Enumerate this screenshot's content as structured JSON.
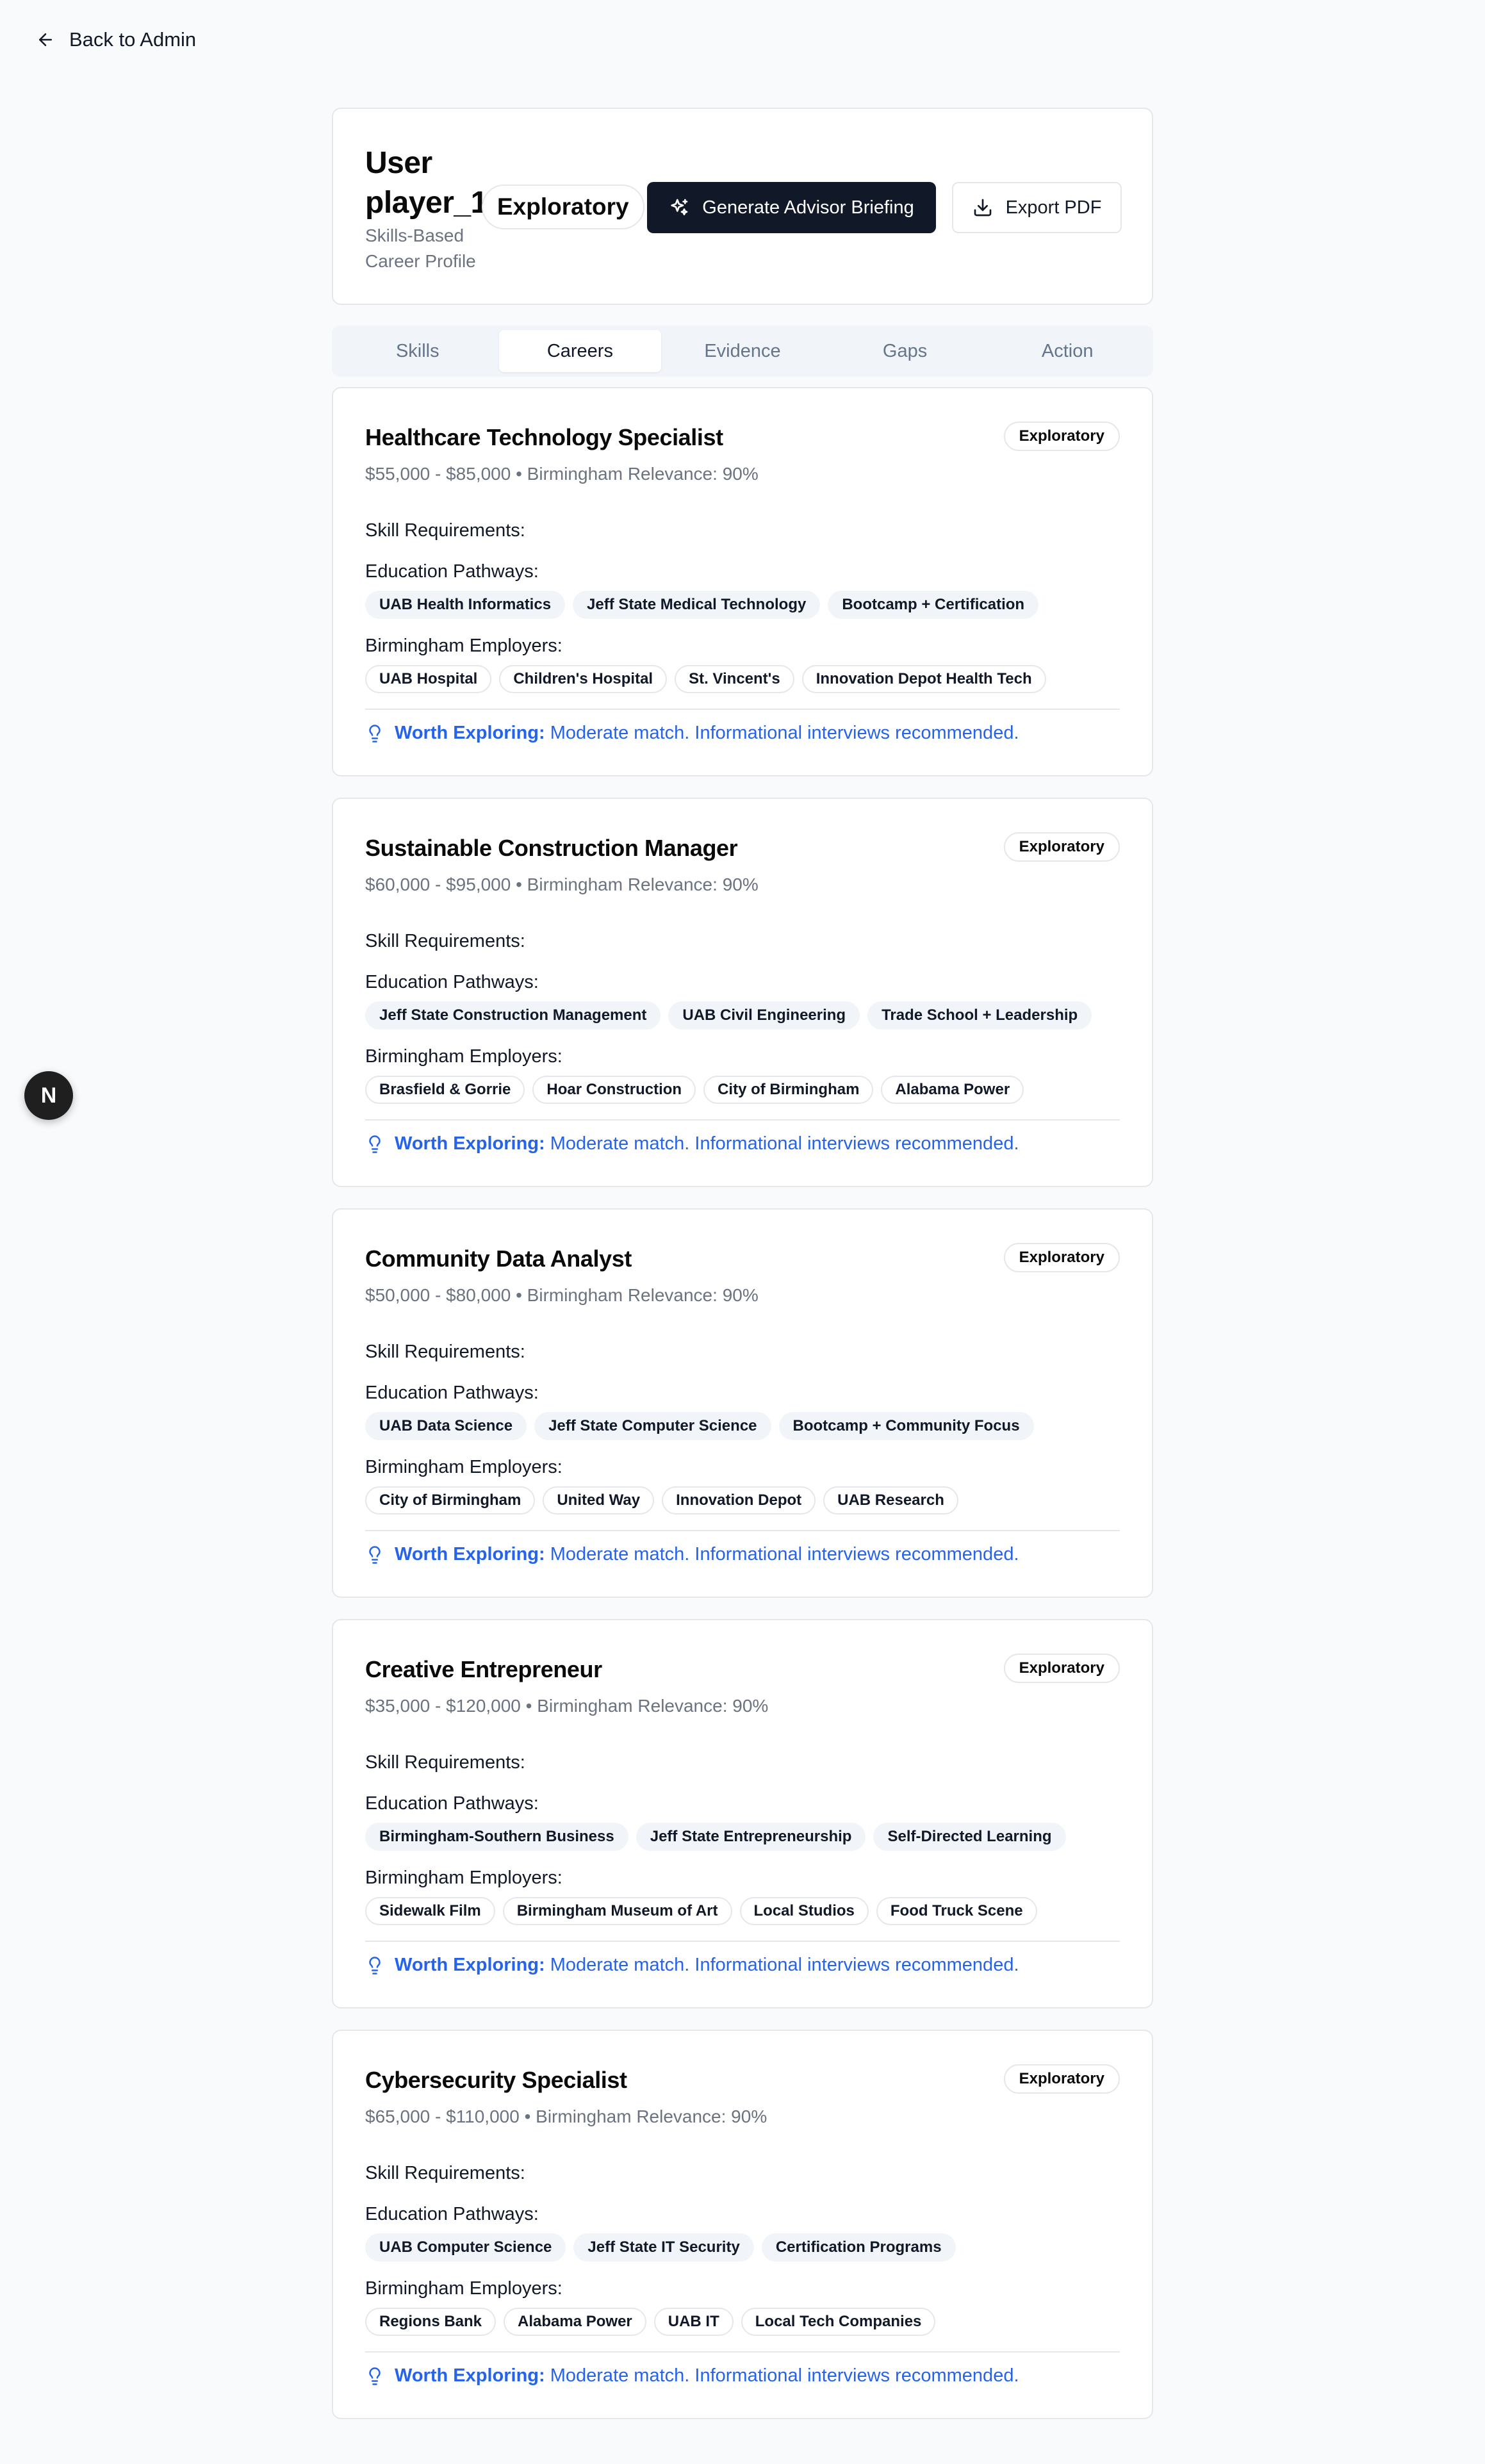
{
  "back": {
    "label": "Back to Admin"
  },
  "header": {
    "title": "User player_1",
    "subtitle": "Skills-Based Career Profile",
    "badge": "Exploratory",
    "generate_label": "Generate Advisor Briefing",
    "export_label": "Export PDF"
  },
  "tabs": [
    {
      "label": "Skills",
      "active": false
    },
    {
      "label": "Careers",
      "active": true
    },
    {
      "label": "Evidence",
      "active": false
    },
    {
      "label": "Gaps",
      "active": false
    },
    {
      "label": "Action",
      "active": false
    }
  ],
  "common": {
    "skill_req_label": "Skill Requirements:",
    "edu_label": "Education Pathways:",
    "emp_label": "Birmingham Employers:",
    "worth_strong": "Worth Exploring:",
    "worth_text": "Moderate match. Informational interviews recommended."
  },
  "careers": [
    {
      "title": "Healthcare Technology Specialist",
      "badge": "Exploratory",
      "meta": "$55,000 - $85,000 • Birmingham Relevance: 90%",
      "education": [
        "UAB Health Informatics",
        "Jeff State Medical Technology",
        "Bootcamp + Certification"
      ],
      "employers": [
        "UAB Hospital",
        "Children's Hospital",
        "St. Vincent's",
        "Innovation Depot Health Tech"
      ]
    },
    {
      "title": "Sustainable Construction Manager",
      "badge": "Exploratory",
      "meta": "$60,000 - $95,000 • Birmingham Relevance: 90%",
      "education": [
        "Jeff State Construction Management",
        "UAB Civil Engineering",
        "Trade School + Leadership"
      ],
      "employers": [
        "Brasfield & Gorrie",
        "Hoar Construction",
        "City of Birmingham",
        "Alabama Power"
      ]
    },
    {
      "title": "Community Data Analyst",
      "badge": "Exploratory",
      "meta": "$50,000 - $80,000 • Birmingham Relevance: 90%",
      "education": [
        "UAB Data Science",
        "Jeff State Computer Science",
        "Bootcamp + Community Focus"
      ],
      "employers": [
        "City of Birmingham",
        "United Way",
        "Innovation Depot",
        "UAB Research"
      ]
    },
    {
      "title": "Creative Entrepreneur",
      "badge": "Exploratory",
      "meta": "$35,000 - $120,000 • Birmingham Relevance: 90%",
      "education": [
        "Birmingham-Southern Business",
        "Jeff State Entrepreneurship",
        "Self-Directed Learning"
      ],
      "employers": [
        "Sidewalk Film",
        "Birmingham Museum of Art",
        "Local Studios",
        "Food Truck Scene"
      ]
    },
    {
      "title": "Cybersecurity Specialist",
      "badge": "Exploratory",
      "meta": "$65,000 - $110,000 • Birmingham Relevance: 90%",
      "education": [
        "UAB Computer Science",
        "Jeff State IT Security",
        "Certification Programs"
      ],
      "employers": [
        "Regions Bank",
        "Alabama Power",
        "UAB IT",
        "Local Tech Companies"
      ]
    }
  ],
  "floating": {
    "letter": "N"
  }
}
